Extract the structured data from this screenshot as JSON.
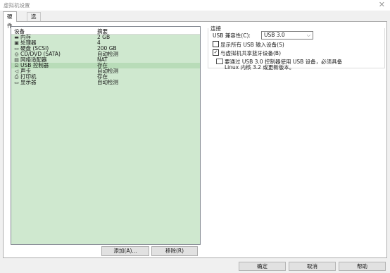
{
  "window": {
    "title": "虚拟机设置"
  },
  "tabs": [
    "硬件",
    "选项"
  ],
  "device_list": {
    "header_device": "设备",
    "header_summary": "摘要",
    "rows": [
      {
        "name": "内存",
        "summary": "2 GB",
        "icon": "memory-icon"
      },
      {
        "name": "处理器",
        "summary": "4",
        "icon": "cpu-icon"
      },
      {
        "name": "硬盘 (SCSI)",
        "summary": "200 GB",
        "icon": "harddisk-icon"
      },
      {
        "name": "CD/DVD (SATA)",
        "summary": "自动检测",
        "icon": "cd-icon"
      },
      {
        "name": "网络适配器",
        "summary": "NAT",
        "icon": "network-icon"
      },
      {
        "name": "USB 控制器",
        "summary": "存在",
        "icon": "usb-icon",
        "selected": true
      },
      {
        "name": "声卡",
        "summary": "自动检测",
        "icon": "sound-icon"
      },
      {
        "name": "打印机",
        "summary": "存在",
        "icon": "printer-icon"
      },
      {
        "name": "显示器",
        "summary": "自动检测",
        "icon": "monitor-icon"
      }
    ],
    "add_label": "添加(A)...",
    "remove_label": "移除(R)"
  },
  "connection": {
    "title": "连接",
    "compat_label": "USB 兼容性(C):",
    "compat_value": "USB 3.0",
    "show_all_label": "显示所有 USB 输入设备(S)",
    "show_all_checked": false,
    "share_bt_label": "与虚拟机共享蓝牙设备(B)",
    "share_bt_checked": true,
    "info_line1": "要通过 USB 3.0 控制器使用 USB 设备，必须具备",
    "info_line2": "Linux 内核 3.2 或更新版本。"
  },
  "footer": {
    "ok": "确定",
    "cancel": "取消",
    "help": "帮助"
  }
}
